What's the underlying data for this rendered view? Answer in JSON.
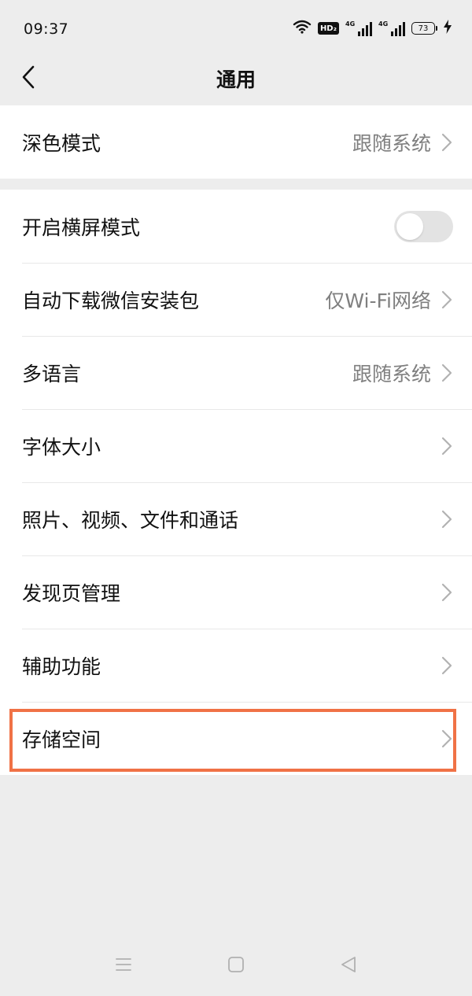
{
  "status_bar": {
    "time": "09:37",
    "hd_badge": "HD₂",
    "network_1": "4G",
    "network_2": "4G",
    "battery": "73",
    "icons": [
      "wifi-icon",
      "hd-icon",
      "signal-icon",
      "signal-icon",
      "battery-icon",
      "charging-icon"
    ]
  },
  "nav": {
    "title": "通用",
    "back_icon": "chevron-left-icon"
  },
  "group1": [
    {
      "label": "深色模式",
      "value": "跟随系统"
    }
  ],
  "group2": {
    "landscape": {
      "label": "开启横屏模式",
      "toggle_on": false
    },
    "auto_download": {
      "label": "自动下载微信安装包",
      "value": "仅Wi-Fi网络"
    },
    "language": {
      "label": "多语言",
      "value": "跟随系统"
    },
    "font_size": {
      "label": "字体大小"
    },
    "media": {
      "label": "照片、视频、文件和通话"
    },
    "discover": {
      "label": "发现页管理"
    },
    "accessibility": {
      "label": "辅助功能"
    },
    "storage": {
      "label": "存储空间"
    }
  },
  "highlight": {
    "target": "存储空间",
    "color": "#f07246"
  },
  "system_nav": {
    "icons": [
      "menu-icon",
      "home-icon",
      "back-triangle-icon"
    ]
  },
  "colors": {
    "background": "#ededed",
    "card": "#ffffff",
    "secondary_text": "#7f7f7f",
    "toggle_off": "#e3e3e3"
  }
}
